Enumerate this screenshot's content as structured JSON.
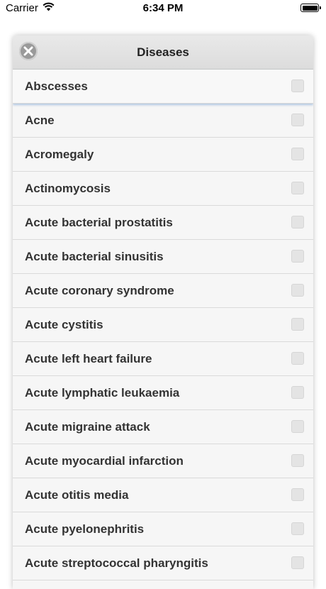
{
  "status_bar": {
    "carrier": "Carrier",
    "time": "6:34 PM",
    "wifi_icon": "wifi-icon",
    "battery_icon": "battery-icon"
  },
  "dialog": {
    "title": "Diseases",
    "close_icon": "close-icon",
    "items": [
      {
        "label": "Abscesses",
        "checked": false
      },
      {
        "label": "Acne",
        "checked": false
      },
      {
        "label": "Acromegaly",
        "checked": false
      },
      {
        "label": "Actinomycosis",
        "checked": false
      },
      {
        "label": "Acute bacterial prostatitis",
        "checked": false
      },
      {
        "label": "Acute bacterial sinusitis",
        "checked": false
      },
      {
        "label": "Acute coronary syndrome",
        "checked": false
      },
      {
        "label": "Acute cystitis",
        "checked": false
      },
      {
        "label": "Acute left heart failure",
        "checked": false
      },
      {
        "label": "Acute lymphatic leukaemia",
        "checked": false
      },
      {
        "label": "Acute migraine attack",
        "checked": false
      },
      {
        "label": "Acute myocardial infarction",
        "checked": false
      },
      {
        "label": "Acute otitis media",
        "checked": false
      },
      {
        "label": "Acute pyelonephritis",
        "checked": false
      },
      {
        "label": "Acute streptococcal pharyngitis",
        "checked": false
      }
    ]
  }
}
